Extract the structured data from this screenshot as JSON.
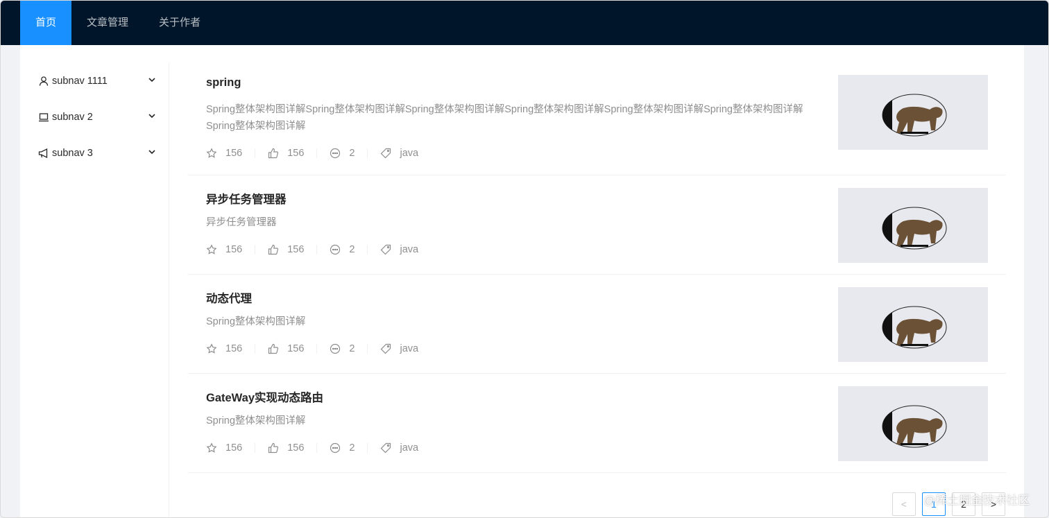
{
  "header": {
    "nav": [
      {
        "label": "首页",
        "active": true
      },
      {
        "label": "文章管理",
        "active": false
      },
      {
        "label": "关于作者",
        "active": false
      }
    ]
  },
  "sidebar": {
    "items": [
      {
        "label": "subnav 1111",
        "icon": "user-icon"
      },
      {
        "label": "subnav 2",
        "icon": "laptop-icon"
      },
      {
        "label": "subnav 3",
        "icon": "notification-icon"
      }
    ]
  },
  "articles": [
    {
      "title": "spring",
      "desc": "Spring整体架构图详解Spring整体架构图详解Spring整体架构图详解Spring整体架构图详解Spring整体架构图详解Spring整体架构图详解Spring整体架构图详解",
      "stars": "156",
      "likes": "156",
      "comments": "2",
      "tag": "java"
    },
    {
      "title": "异步任务管理器",
      "desc": "异步任务管理器",
      "stars": "156",
      "likes": "156",
      "comments": "2",
      "tag": "java"
    },
    {
      "title": "动态代理",
      "desc": "Spring整体架构图详解",
      "stars": "156",
      "likes": "156",
      "comments": "2",
      "tag": "java"
    },
    {
      "title": "GateWay实现动态路由",
      "desc": "Spring整体架构图详解",
      "stars": "156",
      "likes": "156",
      "comments": "2",
      "tag": "java"
    }
  ],
  "pagination": {
    "prev": "<",
    "pages": [
      "1",
      "2"
    ],
    "current": "1",
    "next": ">"
  },
  "watermark": "@稀土掘金技术社区",
  "colors": {
    "header_bg": "#001529",
    "accent": "#1890ff"
  }
}
